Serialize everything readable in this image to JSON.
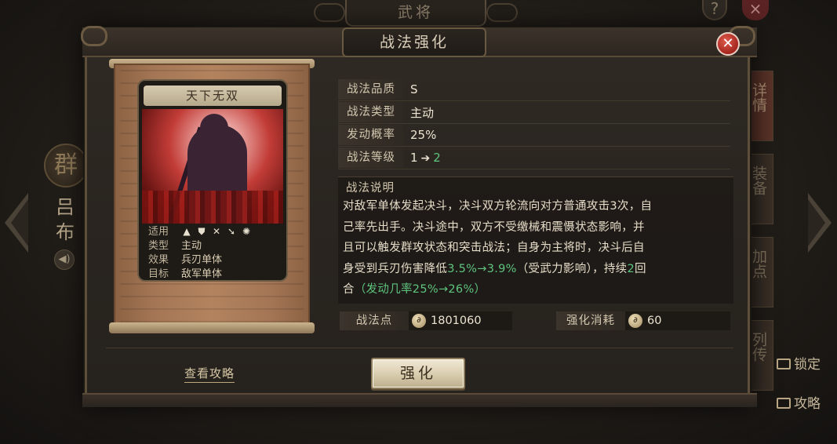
{
  "background": {
    "page_title": "武将",
    "help_icon": "?",
    "close_icon": "×",
    "faction": "群",
    "general_name": "吕布",
    "side_tabs": [
      "详情",
      "装备",
      "加点",
      "列传"
    ],
    "lock_label": "锁定",
    "guide_label": "攻略"
  },
  "modal": {
    "title": "战法强化",
    "card": {
      "name": "天下无双",
      "rows": [
        {
          "key": "适用",
          "value": ""
        },
        {
          "key": "类型",
          "value": "主动"
        },
        {
          "key": "效果",
          "value": "兵刃单体"
        },
        {
          "key": "目标",
          "value": "敌军单体"
        }
      ],
      "applicable_icons": [
        "cavalry-icon",
        "shield-icon",
        "bow-icon",
        "spear-icon",
        "vehicle-icon"
      ]
    },
    "info": {
      "quality_label": "战法品质",
      "quality_value": "S",
      "type_label": "战法类型",
      "type_value": "主动",
      "chance_label": "发动概率",
      "chance_value": "25%",
      "level_label": "战法等级",
      "level_from": "1",
      "level_to": "2"
    },
    "description": {
      "title": "战法说明",
      "line1": "对敌军单体发起决斗，决斗双方轮流向对方普通攻击3次，自",
      "line2": "己率先出手。决斗途中，双方不受缴械和震慑状态影响，并",
      "line3": "且可以触发群攻状态和突击战法；自身为主将时，决斗后自",
      "line4_a": "身受到兵刃伤害降低",
      "line4_b": "3.5%→3.9%",
      "line4_c": "（受武力影响），持续",
      "line4_d": "2",
      "line4_e": "回",
      "line5_a": "合",
      "line5_b": "（发动几率25%→26%）"
    },
    "points_label": "战法点",
    "points_value": "1801060",
    "cost_label": "强化消耗",
    "cost_value": "60",
    "guide_link": "查看攻略",
    "enhance_button": "强化"
  }
}
